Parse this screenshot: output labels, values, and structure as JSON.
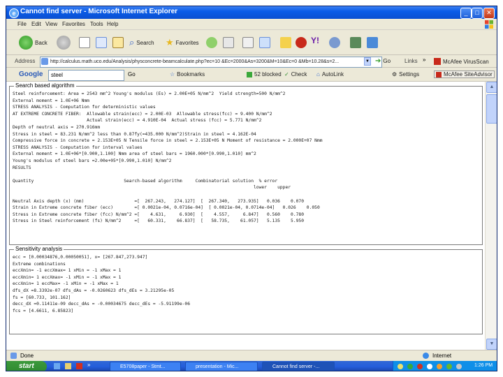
{
  "window": {
    "title": "Cannot find server - Microsoft Internet Explorer"
  },
  "menu": {
    "items": [
      "File",
      "Edit",
      "View",
      "Favorites",
      "Tools",
      "Help"
    ]
  },
  "toolbar": {
    "back": "Back",
    "search": "Search",
    "favorites": "Favorites"
  },
  "address": {
    "label": "Address",
    "url": "http://calculus.math.uco.edu/Analysis/physconcrete-beamcalculate.php?ec=10 &Ec=2000&As=3200&M=10&Ec=0 &Mb=10.28&s=2...",
    "go": "Go",
    "links": "Links",
    "mcafee": "McAfee VirusScan"
  },
  "google": {
    "brand": "Google",
    "query": "steel",
    "go": "Go",
    "bookmarks": "Bookmarks",
    "blocked": "52 blocked",
    "check": "Check",
    "autolink": "AutoLink",
    "settings": "Settings",
    "mcafee": "McAfee SiteAdvisor"
  },
  "panel1": {
    "title": "Search based algorithm",
    "lines": [
      "Steel reinforcement: Area = 2543 mm^2 Young's modulus (Es) = 2.00E+05 N/mm^2  Yield strength=500 N/mm^2",
      "External moment = 1.0E+06 Nmm",
      "STRESS ANALYSIS - Computation for deterministic values",
      "AT EXTREME CONCRETE FIBER:  Allowable strain(ecc) = 2.00E-03  Allowable stress(fcc) = 9.400 N/mm^2",
      "                            Actual strain(ecc) = 4.910E-04  Actual stress (fcc) = 5.771 N/mm^2",
      "Depth of neutral axis = 270.916mm",
      "Stress in steel = 83.231 N/mm^2 less than 0.87fy(=435.000 N/mm^2)Strain in steel = 4.162E-04",
      "Compressive force in concrete = 2.153E+05 N Tensile force in steel = 2.153E+05 N Moment of resistance = 2.000E+07 Nmm",
      "STRESS ANALYSIS - Computation for interval values",
      "External moment = 1.0E+06*[0.900,1.100] Nmm area of steel bars = 1960.000*[0.990,1.010] mm^2",
      "Young's modulus of steel bars =2.00e+05*[0.990,1.010] N/mm^2",
      "RESULTS",
      "",
      "Quantity                                  Search-based algorithm     Combinatorial solution  % error",
      "                                                                                           lower    upper",
      "",
      "Neutral Axis depth (x) (mm)                   =[  267.243,   274.127]  [  267.340,   273.935]   0.036    0.070",
      "Strain in Extreme concrete fiber (ecc)        =[ 0.0021e-04, 0.0716e-04]  [ 0.0021e-04, 0.0714e-04]   0.026    0.050",
      "Stress in Extreme concrete fiber (fcc) N/mm^2 =[    4.631,     6.930]  [    4.557,     6.847]   0.560    0.780",
      "Stress in Steel reinforcement (fs) N/mm^2     =[   60.331,    66.837]  [   58.735,    61.057]   5.135    5.950"
    ]
  },
  "panel2": {
    "title": "Sensitivity analysis",
    "lines": [
      "ecc = [0.00034876,0.00050051], x= [267.847,273.947]",
      "Extreme combinations",
      "eccXmin= -1 eccXmax= 1 xMin = -1 xMax = 1",
      "eccXmin= 1 eccXmax= -1 xMin = -1 xMax = 1",
      "eccXmin= 1 eccMax= -1 xMin = -1 xMax = 1",
      "dfs_dX =8.3392e-07 dfs_dAs = -0.0260623 dfs_dEs = 3.21295e-05",
      "fs = [60.733, 101.162]",
      "decc_dX =0.11411e-09 decc_dAs = -0.00034675 decc_dEs = -5.91199e-06",
      "fcs = [4.6611, 6.85823]"
    ]
  },
  "status": {
    "left": "Done",
    "right": "Internet"
  },
  "taskbar": {
    "start": "start",
    "tasks": [
      "E5708paper - Stmt...",
      "presentation - Mic...",
      "Cannot find server -..."
    ],
    "clock": "1:26 PM"
  }
}
